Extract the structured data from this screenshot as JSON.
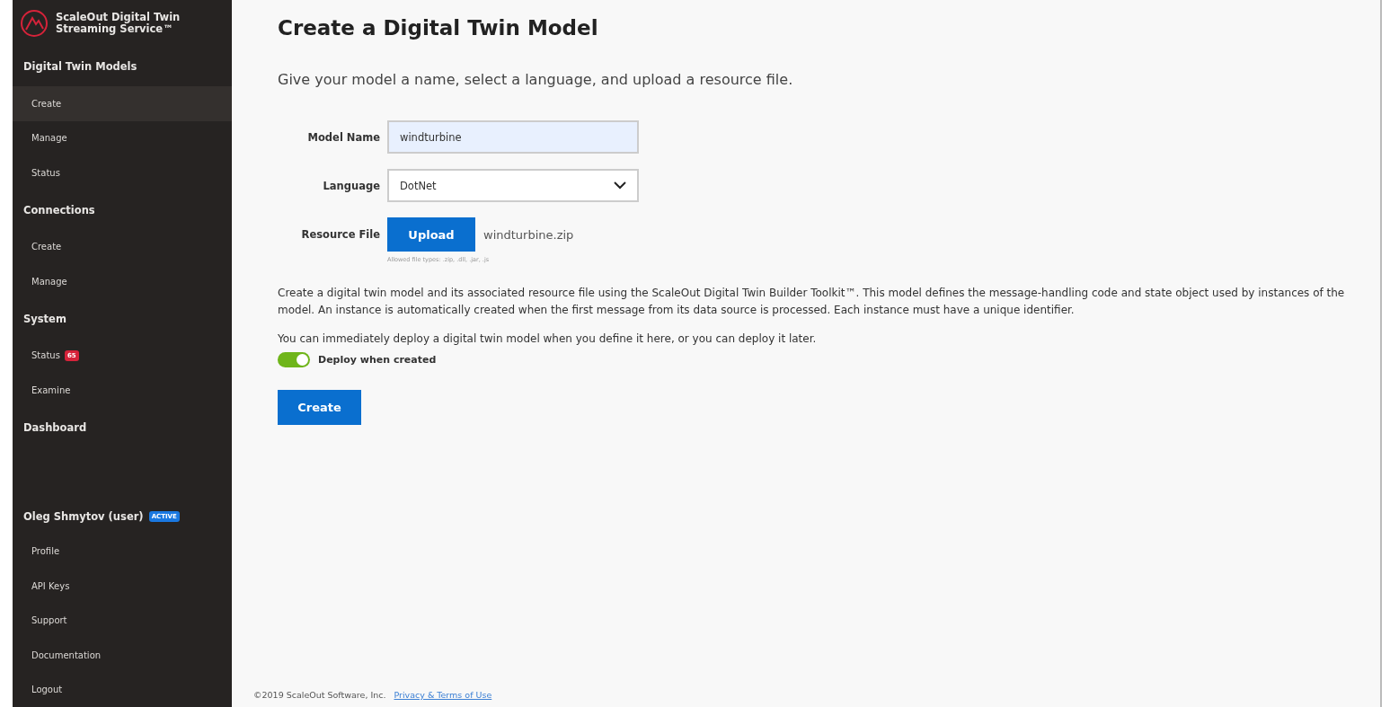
{
  "brand": {
    "title": "ScaleOut Digital Twin",
    "subtitle": "Streaming Service™"
  },
  "sidebar": {
    "sections": [
      {
        "heading": "Digital Twin Models",
        "items": [
          {
            "label": "Create",
            "selected": true
          },
          {
            "label": "Manage",
            "selected": false
          },
          {
            "label": "Status",
            "selected": false
          }
        ]
      },
      {
        "heading": "Connections",
        "items": [
          {
            "label": "Create",
            "selected": false
          },
          {
            "label": "Manage",
            "selected": false
          }
        ]
      },
      {
        "heading": "System",
        "items": [
          {
            "label": "Status",
            "selected": false,
            "badge": "65"
          },
          {
            "label": "Examine",
            "selected": false
          }
        ]
      },
      {
        "heading": "Dashboard"
      }
    ],
    "user": {
      "name": "Oleg Shmytov (user)",
      "badge": "ACTIVE",
      "items": [
        {
          "label": "Profile",
          "selected": false
        },
        {
          "label": "API Keys",
          "selected": false
        },
        {
          "label": "Support",
          "selected": false
        },
        {
          "label": "Documentation",
          "selected": false
        },
        {
          "label": "Logout",
          "selected": false
        }
      ]
    }
  },
  "page": {
    "title": "Create a Digital Twin Model",
    "intro": "Give your model a name, select a language, and upload a resource file.",
    "form": {
      "model_name": {
        "label": "Model Name",
        "value": "windturbine"
      },
      "language": {
        "label": "Language",
        "value": "DotNet"
      },
      "resource_file": {
        "label": "Resource File",
        "button": "Upload",
        "file": "windturbine.zip",
        "hint": "Allowed file types: .zip, .dll, .jar, .js"
      }
    },
    "description": "Create a digital twin model and its associated resource file using the ScaleOut Digital Twin Builder Toolkit™. This model defines the message-handling code and state object used by instances of the model. An instance is automatically created when the first message from its data source is processed. Each instance must have a unique identifier.",
    "deploy_note": "You can immediately deploy a digital twin model when you define it here, or you can deploy it later.",
    "deploy_toggle": {
      "label": "Deploy when created",
      "on": true
    },
    "create_button": "Create"
  },
  "footer": {
    "copyright": "©2019 ScaleOut Software, Inc.",
    "link": "Privacy & Terms of Use"
  }
}
